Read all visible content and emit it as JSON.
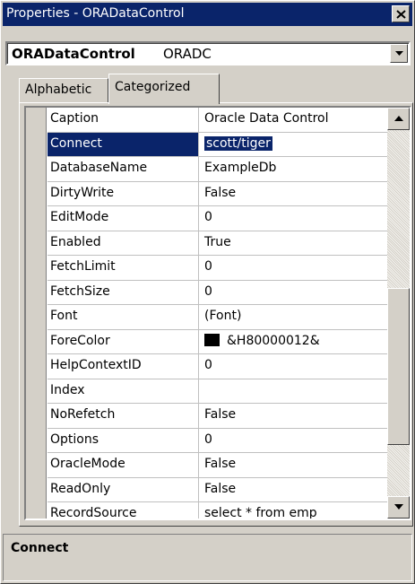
{
  "window": {
    "title": "Properties - ORADataControl"
  },
  "object_selector": {
    "name": "ORADataControl",
    "type": "ORADC"
  },
  "tabs": [
    {
      "label": "Alphabetic",
      "active": false
    },
    {
      "label": "Categorized",
      "active": true
    }
  ],
  "properties": [
    {
      "name": "Caption",
      "value": "Oracle Data Control"
    },
    {
      "name": "Connect",
      "value": "scott/tiger",
      "selected": true
    },
    {
      "name": "DatabaseName",
      "value": "ExampleDb"
    },
    {
      "name": "DirtyWrite",
      "value": "False"
    },
    {
      "name": "EditMode",
      "value": "0"
    },
    {
      "name": "Enabled",
      "value": "True"
    },
    {
      "name": "FetchLimit",
      "value": "0"
    },
    {
      "name": "FetchSize",
      "value": "0"
    },
    {
      "name": "Font",
      "value": "(Font)"
    },
    {
      "name": "ForeColor",
      "value": "&H80000012&",
      "swatch_color": "#000000"
    },
    {
      "name": "HelpContextID",
      "value": "0"
    },
    {
      "name": "Index",
      "value": ""
    },
    {
      "name": "NoRefetch",
      "value": "False"
    },
    {
      "name": "Options",
      "value": "0"
    },
    {
      "name": "OracleMode",
      "value": "False"
    },
    {
      "name": "ReadOnly",
      "value": "False"
    },
    {
      "name": "RecordSource",
      "value": "select * from emp"
    }
  ],
  "description": {
    "title": "Connect"
  },
  "colors": {
    "titlebar": "#0a246a",
    "selection": "#0a246a",
    "face": "#d4d0c8"
  }
}
